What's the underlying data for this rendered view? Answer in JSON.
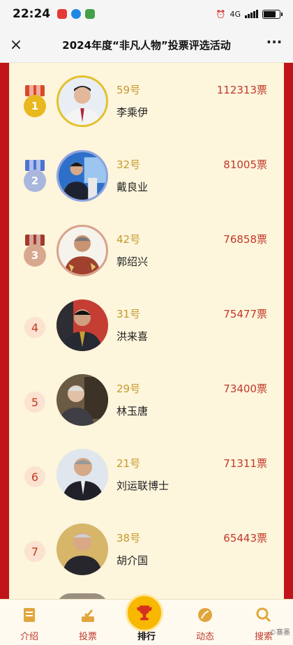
{
  "status": {
    "time": "22:24",
    "network": "4G"
  },
  "header": {
    "title": "2024年度“非凡人物”投票评选活动",
    "close_icon": "×",
    "more_icon": "···"
  },
  "ranking": [
    {
      "rank": "1",
      "number": "59号",
      "name": "李乘伊",
      "votes": "112313票",
      "medal": "gold"
    },
    {
      "rank": "2",
      "number": "32号",
      "name": "戴良业",
      "votes": "81005票",
      "medal": "silver"
    },
    {
      "rank": "3",
      "number": "42号",
      "name": "郭绍兴",
      "votes": "76858票",
      "medal": "bronze"
    },
    {
      "rank": "4",
      "number": "31号",
      "name": "洪来喜",
      "votes": "75477票"
    },
    {
      "rank": "5",
      "number": "29号",
      "name": "林玉唐",
      "votes": "73400票"
    },
    {
      "rank": "6",
      "number": "21号",
      "name": "刘运联博士",
      "votes": "71311票"
    },
    {
      "rank": "7",
      "number": "38号",
      "name": "胡介国",
      "votes": "65443票"
    }
  ],
  "nav": {
    "intro": "介绍",
    "vote": "投票",
    "rank": "排行",
    "news": "动态",
    "search": "搜索",
    "watermark": "©塞墨"
  },
  "colors": {
    "brand_red": "#c0141a",
    "gold": "#e4c12c",
    "silver": "#8fa3e0",
    "bronze": "#d8a18a",
    "accent_number": "#c49a2e",
    "votes": "#c0392b"
  }
}
